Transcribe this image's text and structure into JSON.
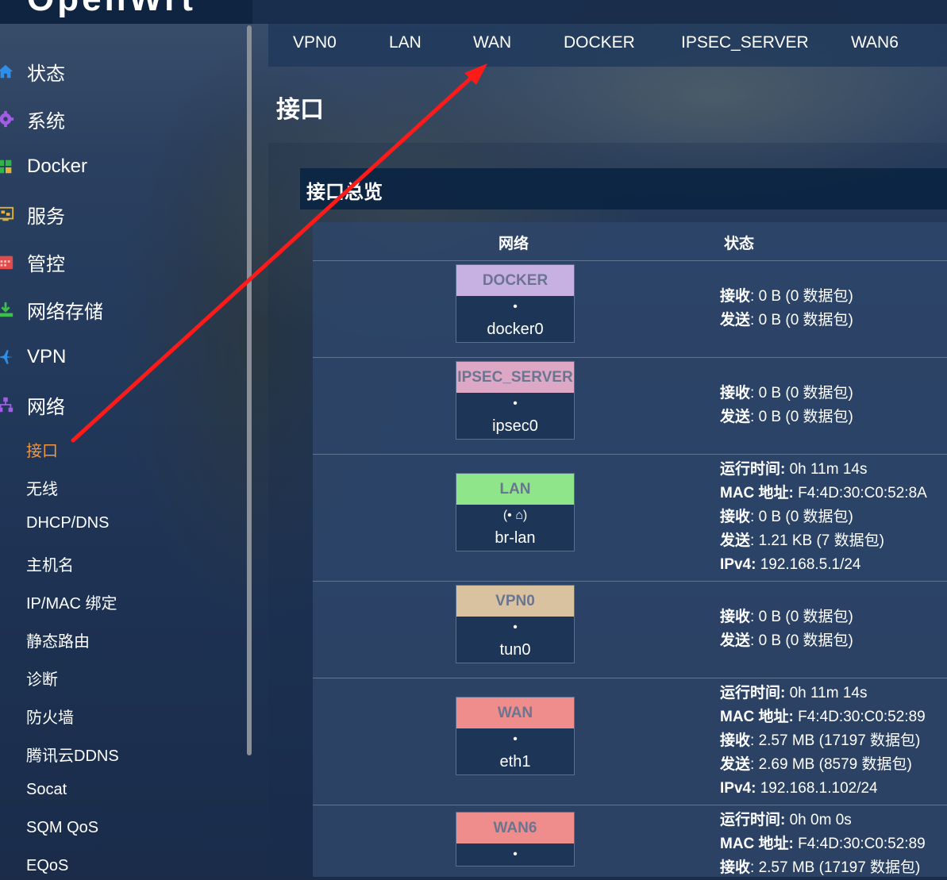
{
  "logo": "OpenWrt",
  "sidebar": {
    "items": [
      {
        "label": "状态",
        "icon": "home-icon",
        "color": "#2f8fe8"
      },
      {
        "label": "系统",
        "icon": "gear-icon",
        "color": "#a35ce6"
      },
      {
        "label": "Docker",
        "icon": "grid-icon",
        "color": "#34b34a"
      },
      {
        "label": "服务",
        "icon": "services-icon",
        "color": "#e6b432"
      },
      {
        "label": "管控",
        "icon": "calendar-icon",
        "color": "#e34a4a"
      },
      {
        "label": "网络存储",
        "icon": "download-icon",
        "color": "#3cc04a"
      },
      {
        "label": "VPN",
        "icon": "vpn-icon",
        "color": "#2f8fe8"
      },
      {
        "label": "网络",
        "icon": "network-icon",
        "color": "#a35ce6"
      }
    ],
    "subitems": [
      "接口",
      "无线",
      "DHCP/DNS",
      "主机名",
      "IP/MAC 绑定",
      "静态路由",
      "诊断",
      "防火墙",
      "腾讯云DDNS",
      "Socat",
      "SQM QoS",
      "EQoS"
    ]
  },
  "tabs": [
    "VPN0",
    "LAN",
    "WAN",
    "DOCKER",
    "IPSEC_SERVER",
    "WAN6"
  ],
  "page_title": "接口",
  "section_title": "接口总览",
  "table": {
    "headers": {
      "network": "网络",
      "status": "状态"
    },
    "rows": [
      {
        "name": "DOCKER",
        "color": "#c7b1e3",
        "device": "docker0",
        "icon": "•",
        "status": [
          [
            "接收",
            ": 0 B (0 数据包)"
          ],
          [
            "发送",
            ": 0 B (0 数据包)"
          ]
        ]
      },
      {
        "name": "IPSEC_SERVER",
        "color": "#dca8c5",
        "device": "ipsec0",
        "icon": "•",
        "status": [
          [
            "接收",
            ": 0 B (0 数据包)"
          ],
          [
            "发送",
            ": 0 B (0 数据包)"
          ]
        ]
      },
      {
        "name": "LAN",
        "color": "#8ee58a",
        "device": "br-lan",
        "icon": "(• ⌂)",
        "status": [
          [
            "运行时间:",
            " 0h 11m 14s"
          ],
          [
            "MAC 地址:",
            " F4:4D:30:C0:52:8A"
          ],
          [
            "接收",
            ": 0 B (0 数据包)"
          ],
          [
            "发送",
            ": 1.21 KB (7 数据包)"
          ],
          [
            "IPv4:",
            " 192.168.5.1/24"
          ]
        ]
      },
      {
        "name": "VPN0",
        "color": "#d8c2a0",
        "device": "tun0",
        "icon": "•",
        "status": [
          [
            "接收",
            ": 0 B (0 数据包)"
          ],
          [
            "发送",
            ": 0 B (0 数据包)"
          ]
        ]
      },
      {
        "name": "WAN",
        "color": "#ef8c8c",
        "device": "eth1",
        "icon": "•",
        "status": [
          [
            "运行时间:",
            " 0h 11m 14s"
          ],
          [
            "MAC 地址:",
            " F4:4D:30:C0:52:89"
          ],
          [
            "接收",
            ": 2.57 MB (17197 数据包)"
          ],
          [
            "发送",
            ": 2.69 MB (8579 数据包)"
          ],
          [
            "IPv4:",
            " 192.168.1.102/24"
          ]
        ]
      },
      {
        "name": "WAN6",
        "color": "#ef8c8c",
        "device": "",
        "icon": "•",
        "status": [
          [
            "运行时间:",
            " 0h 0m 0s"
          ],
          [
            "MAC 地址:",
            " F4:4D:30:C0:52:89"
          ],
          [
            "接收",
            ": 2.57 MB (17197 数据包)"
          ]
        ]
      }
    ]
  },
  "annotation": {
    "color": "#ff1a1a"
  }
}
